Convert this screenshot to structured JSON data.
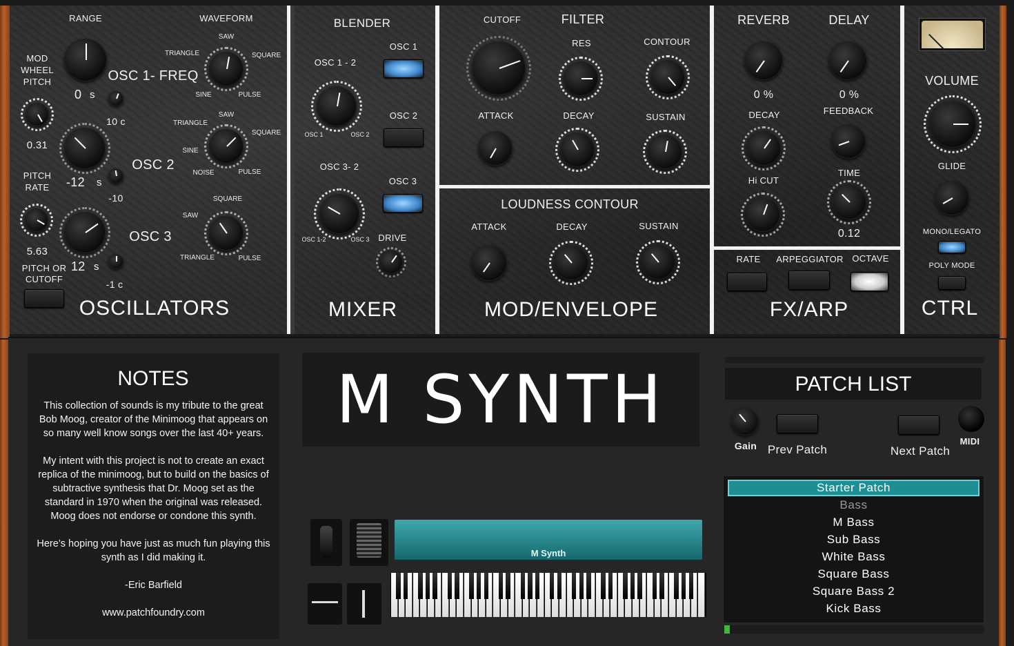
{
  "oscillators": {
    "range_label": "RANGE",
    "waveform_label": "WAVEFORM",
    "mod_wheel_pitch": "MOD\nWHEEL\nPITCH",
    "mod_value": "0.31",
    "pitch_rate": "PITCH\nRATE",
    "pitch_rate_value": "5.63",
    "pitch_or_cutoff": "PITCH OR\nCUTOFF",
    "osc1_freq": "OSC 1- FREQ",
    "osc2": "OSC 2",
    "osc3": "OSC 3",
    "osc1_semi": "0",
    "osc2_semi": "-12",
    "osc3_semi": "12",
    "semi_unit": "s",
    "osc1_cent": "10 c",
    "osc2_cent": "-10",
    "osc3_cent": "-1 c",
    "w1": {
      "saw": "SAW",
      "triangle": "TRIANGLE",
      "square": "SQUARE",
      "sine": "SINE",
      "pulse": "PULSE"
    },
    "w2": {
      "saw": "SAW",
      "triangle": "TRIANGLE",
      "square": "SQUARE",
      "sine": "SINE",
      "noise": "NOISE",
      "pulse": "PULSE"
    },
    "w3": {
      "square": "SQUARE",
      "saw": "SAW",
      "triangle": "TRIANGLE",
      "pulse": "PULSE"
    },
    "section": "OSCILLATORS"
  },
  "mixer": {
    "blender": "BLENDER",
    "osc12": "OSC  1 - 2",
    "osc1": "OSC 1",
    "osc2": "OSC 2",
    "osc3": "OSC 3",
    "osc32": "OSC 3- 2",
    "k1a": "OSC 1",
    "k1b": "OSC 2",
    "k2a": "OSC 1-2",
    "k2b": "OSC 3",
    "drive": "DRIVE",
    "section": "MIXER"
  },
  "filter": {
    "cutoff": "CUTOFF",
    "filter": "FILTER",
    "res": "RES",
    "contour": "CONTOUR",
    "attack": "ATTACK",
    "decay": "DECAY",
    "sustain": "SUSTAIN"
  },
  "loudness": {
    "title": "LOUDNESS CONTOUR",
    "attack": "ATTACK",
    "decay": "DECAY",
    "sustain": "SUSTAIN",
    "section": "MOD/ENVELOPE"
  },
  "fx": {
    "reverb": "REVERB",
    "delay": "DELAY",
    "reverb_value": "0 %",
    "delay_value": "0 %",
    "decay": "DECAY",
    "feedback": "FEEDBACK",
    "hicut": "Hi CUT",
    "time": "TIME",
    "time_value": "0.12",
    "rate": "RATE",
    "arp": "ARPEGGIATOR",
    "octave": "OCTAVE",
    "section": "FX/ARP"
  },
  "ctrl": {
    "volume": "VOLUME",
    "glide": "GLIDE",
    "mono": "MONO/LEGATO",
    "poly": "POLY MODE",
    "section": "CTRL"
  },
  "notes": {
    "title": "NOTES",
    "p1": "This collection of sounds is my tribute to the great Bob Moog, creator of the Minimoog that appears on so many well know songs over the last 40+ years.",
    "p2": "My intent with this project is not to create an exact replica of the minimoog, but to build on the basics of subtractive synthesis that Dr. Moog set as the standard in 1970 when the original was released. Moog does not endorse or condone this synth.",
    "p3": "Here’s hoping you have just as much fun playing this synth as I did making it.",
    "sig": "-Eric Barfield",
    "url": "www.patchfoundry.com"
  },
  "logo": "M SYNTH",
  "keyboard_label": "M Synth",
  "patch": {
    "title": "PATCH LIST",
    "gain": "Gain",
    "prev": "Prev Patch",
    "next": "Next Patch",
    "midi": "MIDI",
    "items": [
      "Starter Patch",
      "Bass",
      "M Bass",
      "Sub Bass",
      "White Bass",
      "Square Bass",
      "Square Bass 2",
      "Kick Bass"
    ],
    "selected": 0
  },
  "colors": {
    "accent": "#1e8e95",
    "led": "#7fc3ff",
    "wood": "#b8612a"
  }
}
